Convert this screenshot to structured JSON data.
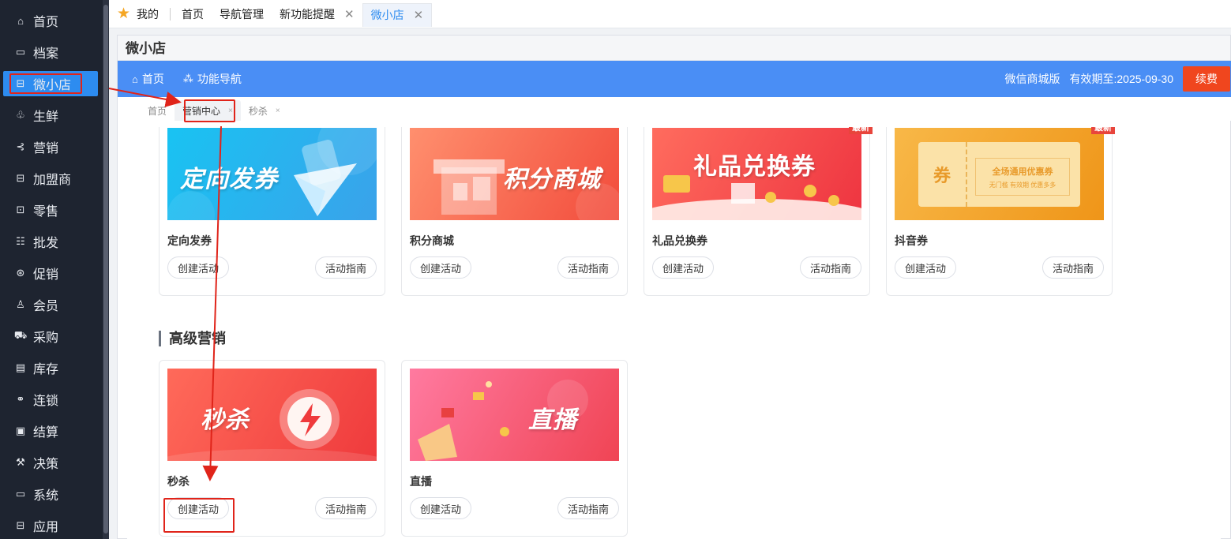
{
  "sidebar": {
    "items": [
      {
        "label": "首页",
        "icon": "home-icon",
        "glyph": "⌂"
      },
      {
        "label": "档案",
        "icon": "folder-icon",
        "glyph": "▭"
      },
      {
        "label": "微小店",
        "icon": "shop-icon",
        "glyph": "⊟",
        "active": true
      },
      {
        "label": "生鲜",
        "icon": "fresh-icon",
        "glyph": "♧"
      },
      {
        "label": "营销",
        "icon": "marketing-icon",
        "glyph": "⊰"
      },
      {
        "label": "加盟商",
        "icon": "franchise-icon",
        "glyph": "⊟"
      },
      {
        "label": "零售",
        "icon": "retail-icon",
        "glyph": "⊡"
      },
      {
        "label": "批发",
        "icon": "wholesale-icon",
        "glyph": "☷"
      },
      {
        "label": "促销",
        "icon": "promotion-icon",
        "glyph": "⊛"
      },
      {
        "label": "会员",
        "icon": "member-icon",
        "glyph": "♙"
      },
      {
        "label": "采购",
        "icon": "cart-icon",
        "glyph": "⛟"
      },
      {
        "label": "库存",
        "icon": "inventory-icon",
        "glyph": "▤"
      },
      {
        "label": "连锁",
        "icon": "link-icon",
        "glyph": "⚭"
      },
      {
        "label": "结算",
        "icon": "settlement-icon",
        "glyph": "▣"
      },
      {
        "label": "决策",
        "icon": "gavel-icon",
        "glyph": "⚒"
      },
      {
        "label": "系统",
        "icon": "monitor-icon",
        "glyph": "▭"
      },
      {
        "label": "应用",
        "icon": "app-icon",
        "glyph": "⊟"
      }
    ]
  },
  "toptabs": {
    "mine": "我的",
    "items": [
      {
        "label": "首页",
        "closable": false
      },
      {
        "label": "导航管理",
        "closable": false
      },
      {
        "label": "新功能提醒",
        "closable": true
      },
      {
        "label": "微小店",
        "closable": true,
        "selected": true
      }
    ],
    "close_glyph": "✕"
  },
  "window": {
    "title": "微小店",
    "bluebar": {
      "home": "首页",
      "func_nav": "功能导航",
      "edition": "微信商城版",
      "validity": "有效期至:2025-09-30",
      "renew": "续费"
    },
    "subtabs": [
      {
        "label": "首页",
        "closable": false
      },
      {
        "label": "营销中心",
        "closable": true,
        "selected": true
      },
      {
        "label": "秒杀",
        "closable": true
      }
    ],
    "subtab_close": "×"
  },
  "cards_row1": [
    {
      "banner": "定向发券",
      "name": "定向发券",
      "new": false,
      "colors": [
        "#1cc4f0",
        "#35a7ea"
      ]
    },
    {
      "banner": "积分商城",
      "name": "积分商城",
      "new": false,
      "colors": [
        "#ff8a6a",
        "#f25440"
      ]
    },
    {
      "banner": "礼品兑换券",
      "name": "礼品兑换券",
      "new": true,
      "colors": [
        "#ff6a5c",
        "#f0383e"
      ]
    },
    {
      "banner": "券",
      "name": "抖音券",
      "new": true,
      "colors": [
        "#f8b545",
        "#f09a20"
      ],
      "ticket_main": "全场通用优惠券",
      "ticket_sub": "无门槛 有效期 优惠多多"
    }
  ],
  "section_title": "高级营销",
  "cards_row2": [
    {
      "banner": "秒杀",
      "name": "秒杀",
      "new": false,
      "colors": [
        "#ff6a5c",
        "#f0383e"
      ]
    },
    {
      "banner": "直播",
      "name": "直播",
      "new": false,
      "colors": [
        "#ff8a9a",
        "#f0425a"
      ]
    }
  ],
  "buttons": {
    "create": "创建活动",
    "guide": "活动指南"
  },
  "new_tag": "最新"
}
